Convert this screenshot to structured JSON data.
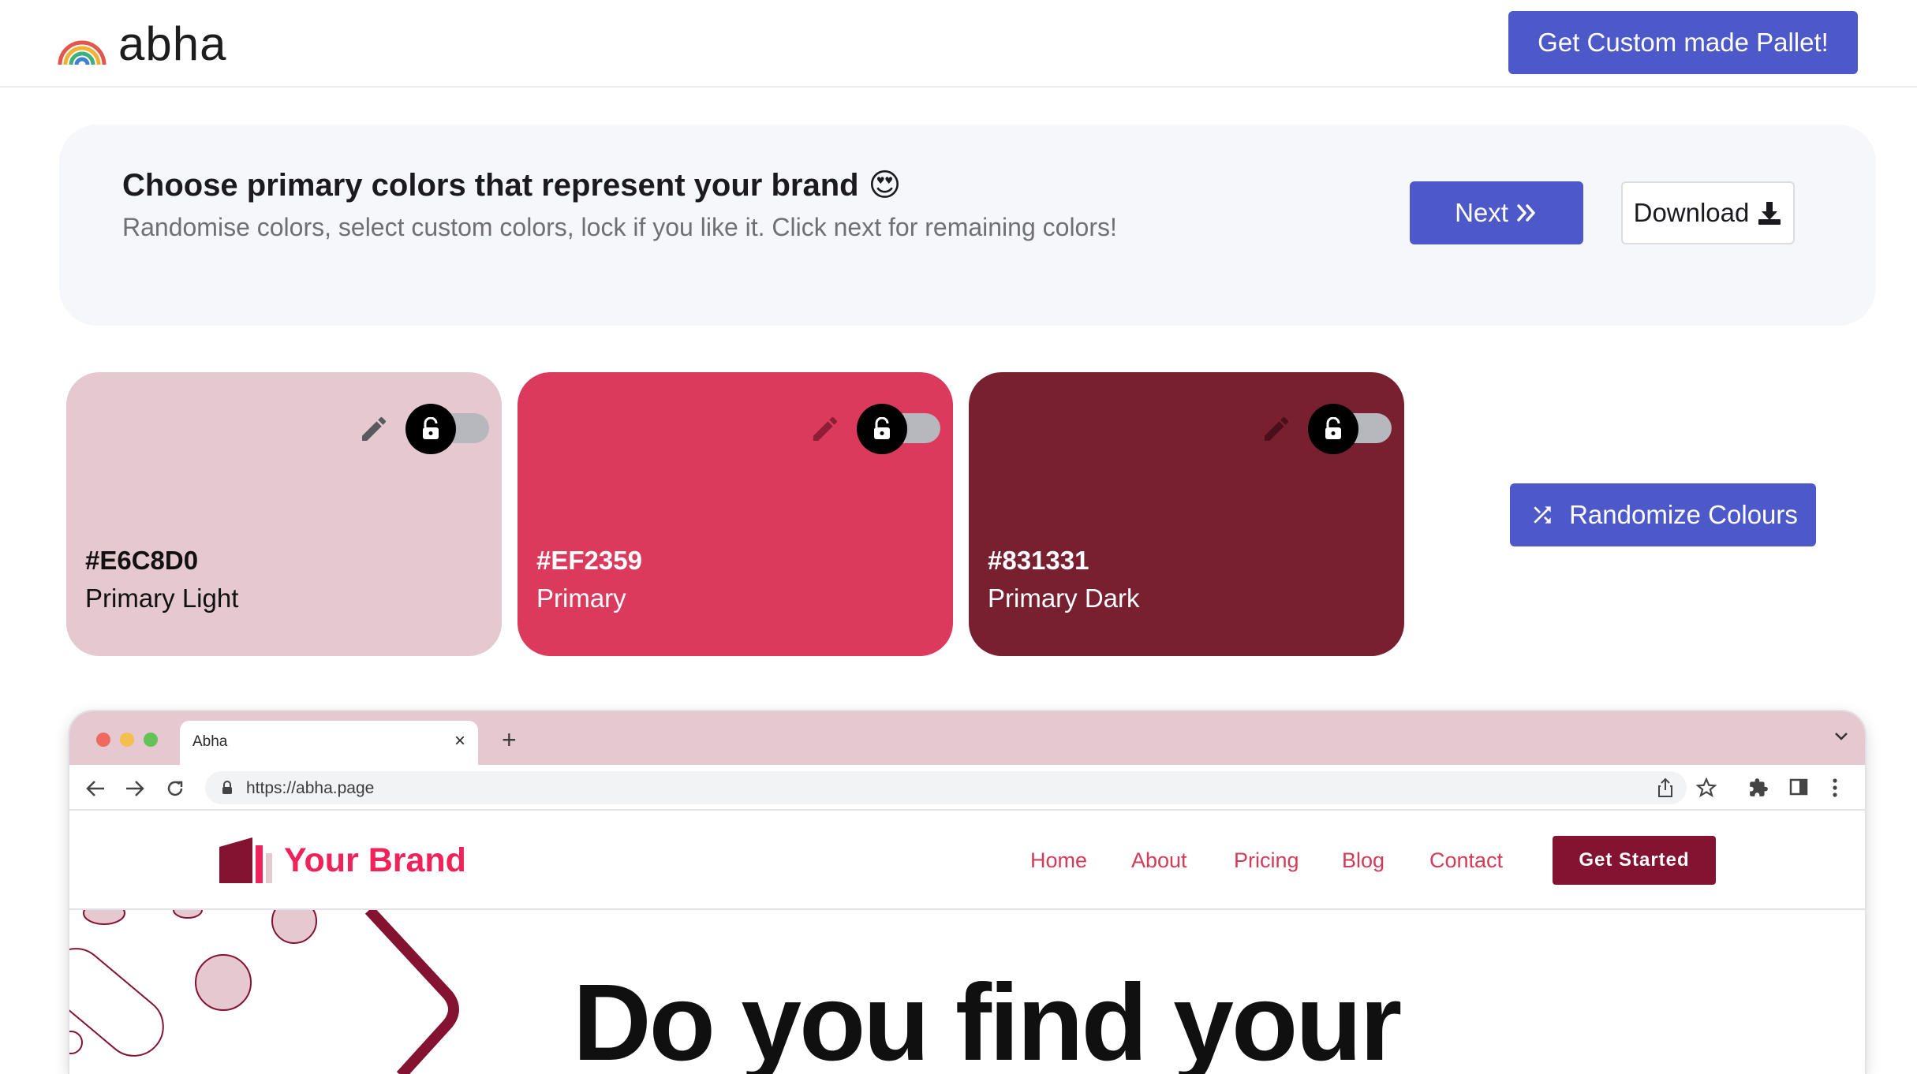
{
  "header": {
    "logo_text": "abha",
    "cta_label": "Get Custom made Pallet!"
  },
  "panel": {
    "title": "Choose primary colors that represent your brand",
    "emoji": "😍",
    "subtitle": "Randomise colors, select custom colors, lock if you like it. Click next for remaining colors!",
    "next_label": "Next",
    "download_label": "Download"
  },
  "swatches": [
    {
      "hex": "#E6C8D0",
      "name": "Primary Light",
      "bg": "#E6C8D0",
      "fg": "#111111",
      "locked": false
    },
    {
      "hex": "#EF2359",
      "name": "Primary",
      "bg": "#DC3A5C",
      "fg": "#ffffff",
      "locked": false
    },
    {
      "hex": "#831331",
      "name": "Primary Dark",
      "bg": "#781F30",
      "fg": "#ffffff",
      "locked": false
    }
  ],
  "randomize_label": "Randomize Colours",
  "browser": {
    "tab_title": "Abha",
    "url": "https://abha.page"
  },
  "preview": {
    "brand_name": "Your Brand",
    "nav": [
      "Home",
      "About",
      "Pricing",
      "Blog",
      "Contact"
    ],
    "cta": "Get Started",
    "hero": "Do you find your"
  },
  "colors": {
    "accent": "#4d59c9",
    "panel_bg": "#f6f7fa"
  }
}
